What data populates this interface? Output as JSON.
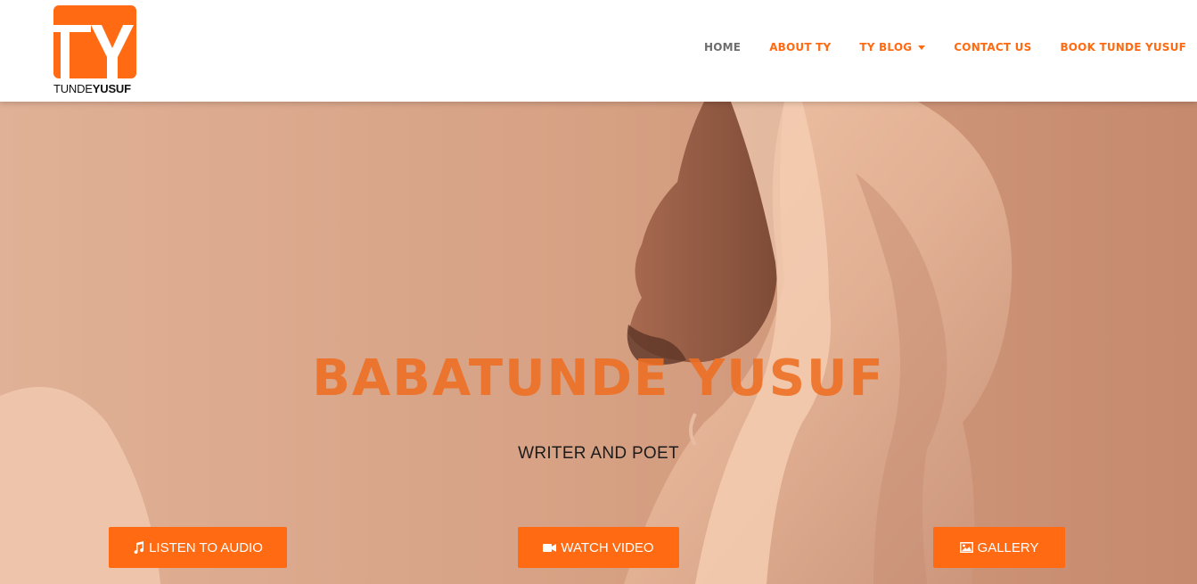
{
  "logo": {
    "mark_letters": "TY",
    "word_thin": "TUNDE",
    "word_bold": "YUSUF"
  },
  "nav": {
    "items": [
      {
        "label": "HOME",
        "active": true
      },
      {
        "label": "ABOUT TY"
      },
      {
        "label": "TY BLOG",
        "has_dropdown": true
      },
      {
        "label": "CONTACT US"
      },
      {
        "label": "BOOK TUNDE YUSUF"
      }
    ]
  },
  "hero": {
    "title": "BABATUNDE YUSUF",
    "subtitle": "WRITER AND POET"
  },
  "buttons": {
    "audio": {
      "label": "LISTEN TO AUDIO",
      "icon": "music-note-icon"
    },
    "video": {
      "label": "WATCH VIDEO",
      "icon": "video-camera-icon"
    },
    "gallery": {
      "label": "GALLERY",
      "icon": "image-icon"
    }
  },
  "colors": {
    "brand": "#ff6a13",
    "nav_active": "#6d6d6d",
    "hero_tint": "#d9a487"
  }
}
